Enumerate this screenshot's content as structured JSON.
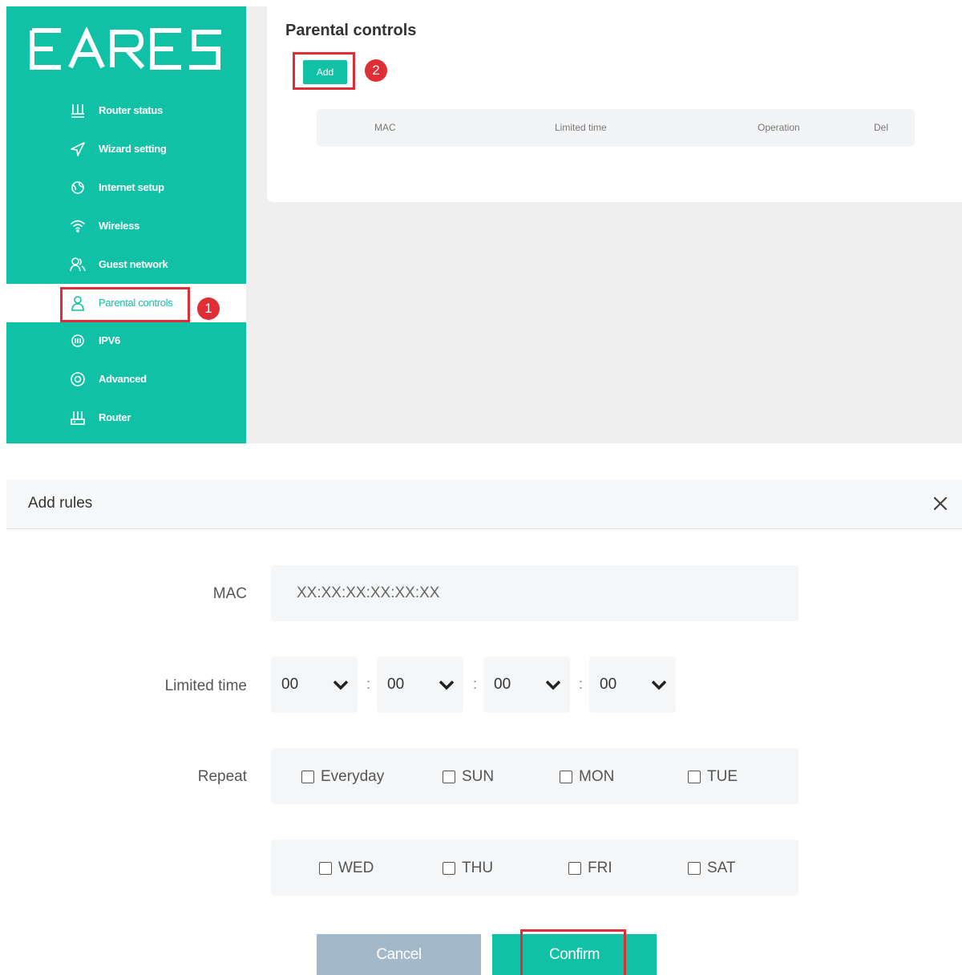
{
  "sidebar": {
    "logo_text": "EARES",
    "items": [
      {
        "label": "Router status",
        "icon": "router-icon"
      },
      {
        "label": "Wizard setting",
        "icon": "send-icon"
      },
      {
        "label": "Internet setup",
        "icon": "globe-icon"
      },
      {
        "label": "Wireless",
        "icon": "wifi-icon"
      },
      {
        "label": "Guest network",
        "icon": "users-icon"
      },
      {
        "label": "Parental controls",
        "icon": "user-icon"
      },
      {
        "label": "IPV6",
        "icon": "ipv6-icon"
      },
      {
        "label": "Advanced",
        "icon": "target-icon"
      },
      {
        "label": "Router",
        "icon": "router-icon"
      }
    ],
    "active_index": 5
  },
  "main": {
    "title": "Parental controls",
    "add_label": "Add",
    "table_headers": [
      "MAC",
      "Limited time",
      "Operation",
      "Del"
    ]
  },
  "steps": [
    "1",
    "2"
  ],
  "dialog": {
    "title": "Add rules",
    "mac_label": "MAC",
    "mac_placeholder": "XX:XX:XX:XX:XX:XX",
    "time_label": "Limited time",
    "time_values": [
      "00",
      "00",
      "00",
      "00"
    ],
    "separator": ":",
    "repeat_label": "Repeat",
    "days_row1": [
      "Everyday",
      "SUN",
      "MON",
      "TUE"
    ],
    "days_row2": [
      "WED",
      "THU",
      "FRI",
      "SAT"
    ],
    "cancel_label": "Cancel",
    "confirm_label": "Confirm"
  },
  "colors": {
    "accent": "#10c1a6",
    "highlight": "#e02e36",
    "cancel": "#a3b9c9"
  }
}
